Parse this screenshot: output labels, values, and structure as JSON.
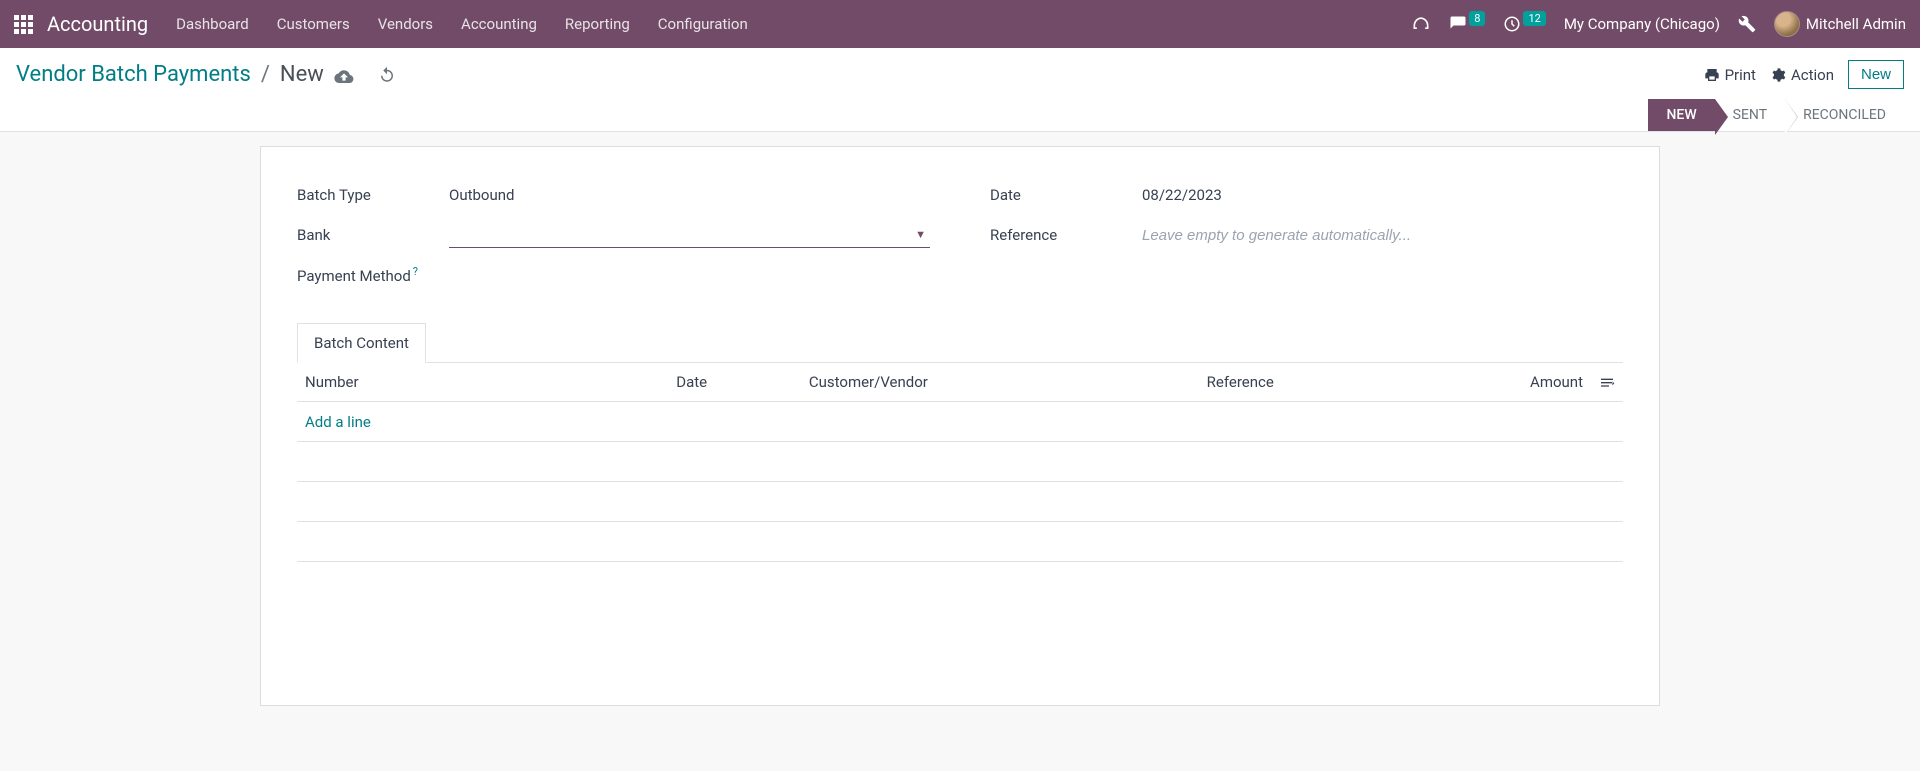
{
  "navbar": {
    "app_name": "Accounting",
    "menu": [
      "Dashboard",
      "Customers",
      "Vendors",
      "Accounting",
      "Reporting",
      "Configuration"
    ],
    "messages_count": "8",
    "activities_count": "12",
    "company": "My Company (Chicago)",
    "user_name": "Mitchell Admin"
  },
  "breadcrumb": {
    "parent": "Vendor Batch Payments",
    "current": "New"
  },
  "actions": {
    "print": "Print",
    "action": "Action",
    "new": "New"
  },
  "status": {
    "steps": [
      "NEW",
      "SENT",
      "RECONCILED"
    ],
    "active_index": 0
  },
  "form": {
    "batch_type_label": "Batch Type",
    "batch_type_value": "Outbound",
    "bank_label": "Bank",
    "bank_value": "",
    "payment_method_label": "Payment Method",
    "date_label": "Date",
    "date_value": "08/22/2023",
    "reference_label": "Reference",
    "reference_placeholder": "Leave empty to generate automatically...",
    "reference_value": ""
  },
  "tabs": {
    "batch_content": "Batch Content"
  },
  "table": {
    "headers": {
      "number": "Number",
      "date": "Date",
      "partner": "Customer/Vendor",
      "reference": "Reference",
      "amount": "Amount"
    },
    "add_line": "Add a line"
  }
}
